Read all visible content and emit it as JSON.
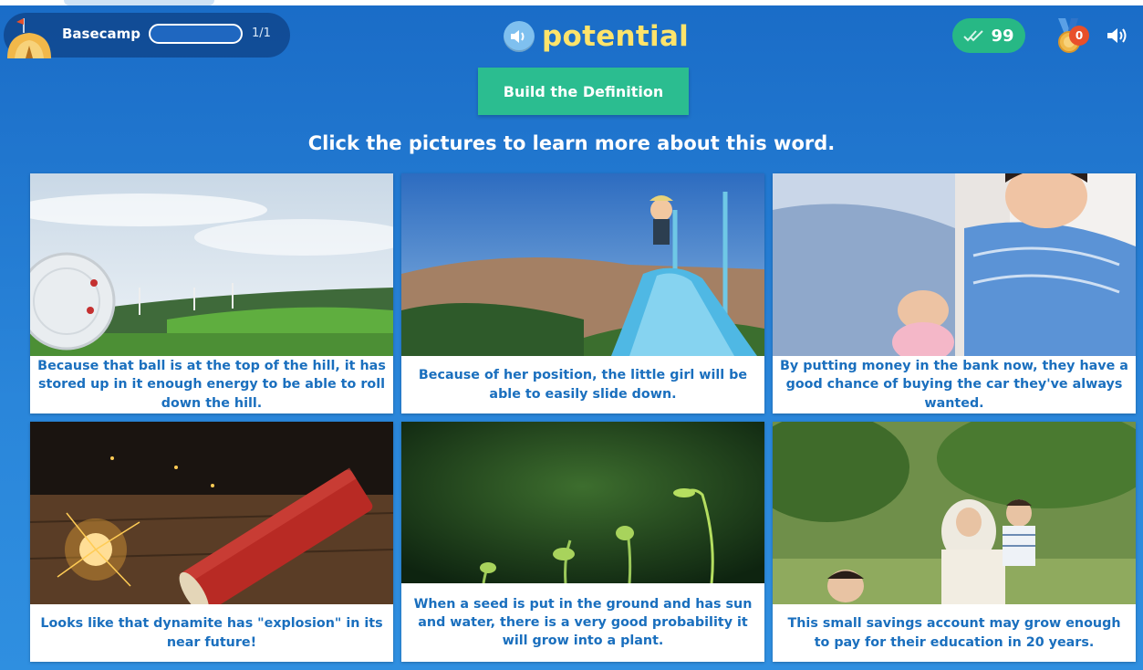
{
  "header": {
    "camp_label": "Basecamp",
    "progress_count": "1/1",
    "progress_fraction": 0.0,
    "word": "potential",
    "points": "99",
    "medal_count": "0"
  },
  "build_button": "Build the Definition",
  "instructions": "Click the pictures to learn more about this word.",
  "cards": [
    {
      "caption": "Because that ball is at the top of the hill, it has stored up in it enough energy to be able to roll down the hill."
    },
    {
      "caption": "Because of her position, the little girl will be able to easily slide down."
    },
    {
      "caption": "By putting money in the bank now, they have a good chance of buying the car they've always wanted."
    },
    {
      "caption": "Looks like that dynamite has \"explosion\" in its near future!"
    },
    {
      "caption": "When a seed is put in the ground and has sun and water, there is a very good probability it will grow into a plant."
    },
    {
      "caption": "This small savings account may grow enough to pay for their education in 20 years."
    }
  ],
  "colors": {
    "accent_green": "#2bbd90",
    "word_yellow": "#ffe46b",
    "caption_blue": "#1a6fbe",
    "badge_orange": "#e8502a"
  },
  "icons": [
    "camp-tent-icon",
    "speaker-icon",
    "checkmarks-icon",
    "medal-icon",
    "volume-icon"
  ]
}
